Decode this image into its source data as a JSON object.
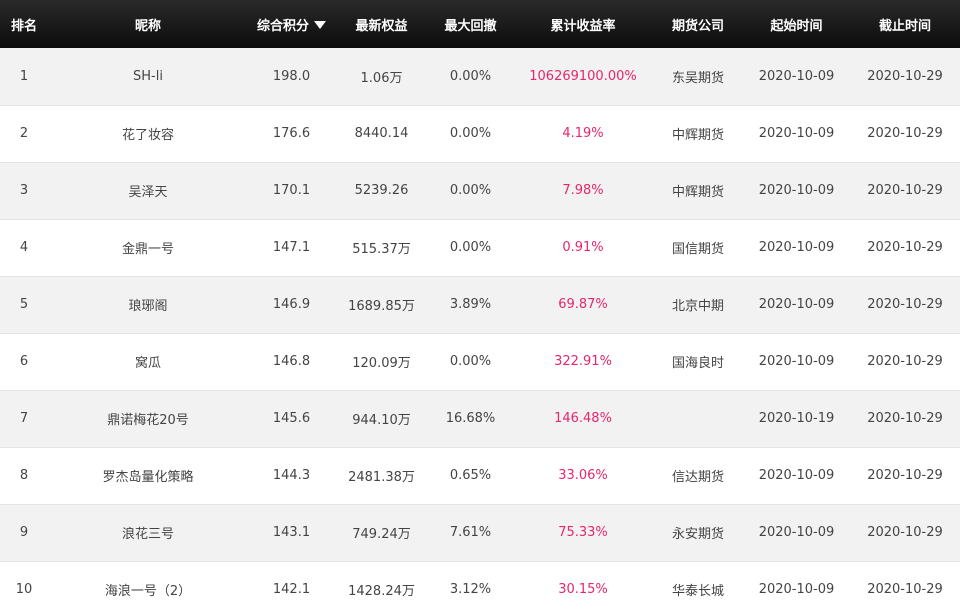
{
  "colors": {
    "header_bg": "#111111",
    "odd_row": "#f2f2f2",
    "even_row": "#ffffff",
    "return_text": "#e6266e"
  },
  "sort_icon": "caret-down-icon",
  "headers": {
    "rank": "排名",
    "name": "昵称",
    "score": "综合积分",
    "equity": "最新权益",
    "drawdown": "最大回撤",
    "return": "累计收益率",
    "company": "期货公司",
    "start": "起始时间",
    "end": "截止时间"
  },
  "rows": [
    {
      "rank": "1",
      "name": "SH-li",
      "score": "198.0",
      "equity": "1.06万",
      "drawdown": "0.00%",
      "return": "106269100.00%",
      "company": "东吴期货",
      "start": "2020-10-09",
      "end": "2020-10-29"
    },
    {
      "rank": "2",
      "name": "花了妆容",
      "score": "176.6",
      "equity": "8440.14",
      "drawdown": "0.00%",
      "return": "4.19%",
      "company": "中辉期货",
      "start": "2020-10-09",
      "end": "2020-10-29"
    },
    {
      "rank": "3",
      "name": "吴泽天",
      "score": "170.1",
      "equity": "5239.26",
      "drawdown": "0.00%",
      "return": "7.98%",
      "company": "中辉期货",
      "start": "2020-10-09",
      "end": "2020-10-29"
    },
    {
      "rank": "4",
      "name": "金鼎一号",
      "score": "147.1",
      "equity": "515.37万",
      "drawdown": "0.00%",
      "return": "0.91%",
      "company": "国信期货",
      "start": "2020-10-09",
      "end": "2020-10-29"
    },
    {
      "rank": "5",
      "name": "琅琊阁",
      "score": "146.9",
      "equity": "1689.85万",
      "drawdown": "3.89%",
      "return": "69.87%",
      "company": "北京中期",
      "start": "2020-10-09",
      "end": "2020-10-29"
    },
    {
      "rank": "6",
      "name": "窝瓜",
      "score": "146.8",
      "equity": "120.09万",
      "drawdown": "0.00%",
      "return": "322.91%",
      "company": "国海良时",
      "start": "2020-10-09",
      "end": "2020-10-29"
    },
    {
      "rank": "7",
      "name": "鼎诺梅花20号",
      "score": "145.6",
      "equity": "944.10万",
      "drawdown": "16.68%",
      "return": "146.48%",
      "company": "",
      "start": "2020-10-19",
      "end": "2020-10-29"
    },
    {
      "rank": "8",
      "name": "罗杰岛量化策略",
      "score": "144.3",
      "equity": "2481.38万",
      "drawdown": "0.65%",
      "return": "33.06%",
      "company": "信达期货",
      "start": "2020-10-09",
      "end": "2020-10-29"
    },
    {
      "rank": "9",
      "name": "浪花三号",
      "score": "143.1",
      "equity": "749.24万",
      "drawdown": "7.61%",
      "return": "75.33%",
      "company": "永安期货",
      "start": "2020-10-09",
      "end": "2020-10-29"
    },
    {
      "rank": "10",
      "name": "海浪一号（2）",
      "score": "142.1",
      "equity": "1428.24万",
      "drawdown": "3.12%",
      "return": "30.15%",
      "company": "华泰长城",
      "start": "2020-10-09",
      "end": "2020-10-29"
    }
  ]
}
